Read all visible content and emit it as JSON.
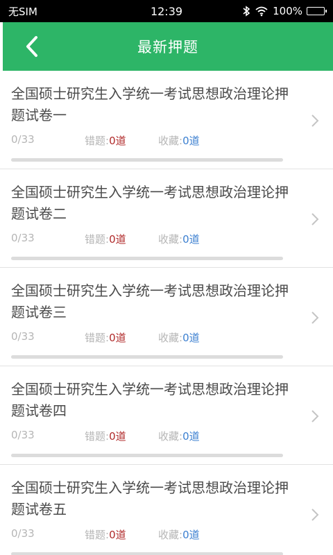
{
  "status_bar": {
    "carrier": "无SIM",
    "time": "12:39",
    "battery": "100%",
    "battery_level": 1.0
  },
  "nav": {
    "title": "最新押题",
    "back_icon": "chevron-left-icon"
  },
  "items": [
    {
      "title": "全国硕士研究生入学统一考试思想政治理论押题试卷一",
      "progress": "0/33",
      "progress_fraction": 0,
      "wrong_label": "错题:",
      "wrong_value": "0道",
      "fav_label": "收藏:",
      "fav_value": "0道"
    },
    {
      "title": "全国硕士研究生入学统一考试思想政治理论押题试卷二",
      "progress": "0/33",
      "progress_fraction": 0,
      "wrong_label": "错题:",
      "wrong_value": "0道",
      "fav_label": "收藏:",
      "fav_value": "0道"
    },
    {
      "title": "全国硕士研究生入学统一考试思想政治理论押题试卷三",
      "progress": "0/33",
      "progress_fraction": 0,
      "wrong_label": "错题:",
      "wrong_value": "0道",
      "fav_label": "收藏:",
      "fav_value": "0道"
    },
    {
      "title": "全国硕士研究生入学统一考试思想政治理论押题试卷四",
      "progress": "0/33",
      "progress_fraction": 0,
      "wrong_label": "错题:",
      "wrong_value": "0道",
      "fav_label": "收藏:",
      "fav_value": "0道"
    },
    {
      "title": "全国硕士研究生入学统一考试思想政治理论押题试卷五",
      "progress": "0/33",
      "progress_fraction": 0,
      "wrong_label": "错题:",
      "wrong_value": "0道",
      "fav_label": "收藏:",
      "fav_value": "0道"
    }
  ],
  "colors": {
    "accent": "#2db567",
    "wrong": "#b02a2a",
    "favorite": "#3b7fd0"
  }
}
